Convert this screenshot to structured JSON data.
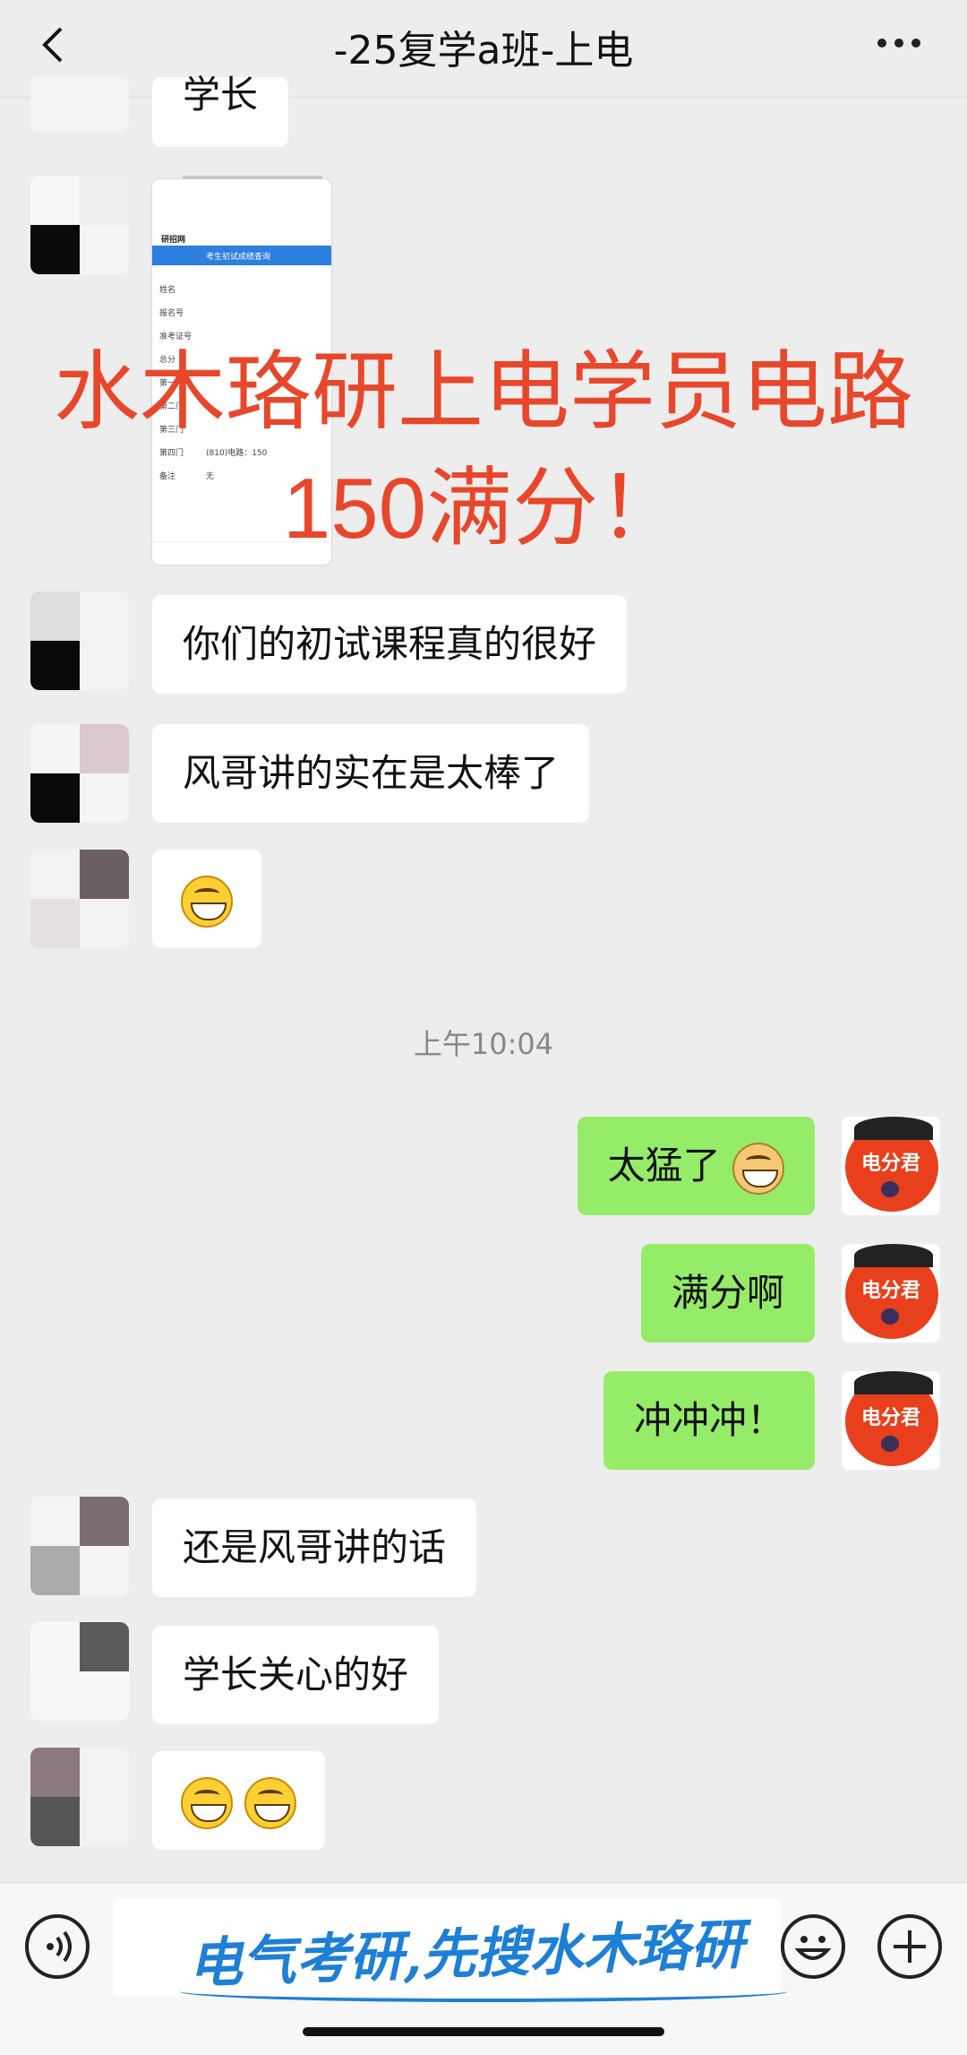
{
  "header": {
    "title": "-25复学a班-上电"
  },
  "messages": {
    "top_partial": "学长",
    "m1": "你们的初试课程真的很好",
    "m2": "风哥讲的实在是太棒了",
    "time": "上午10:04",
    "s1": "太猛了",
    "s2": "满分啊",
    "s3": "冲冲冲！",
    "m4": "还是风哥讲的话",
    "m5": "学长关心的好"
  },
  "card": {
    "brand": "研招网",
    "banner": "考生初试成绩查询",
    "rows": [
      "姓名",
      "报名号",
      "准考证号",
      "总分",
      "第一门",
      "第二门",
      "第三门",
      "第四门",
      "备注"
    ],
    "fourth_value": "(810)电路：150",
    "note_value": "无"
  },
  "overlay": {
    "line1": "水木珞研上电学员电路",
    "line2": "150满分！"
  },
  "avatar_label": "电分君",
  "composer": {
    "slogan": "电气考研,先搜水木珞研"
  },
  "colors": {
    "green_bubble": "#95ec69",
    "overlay_red": "#e8472b",
    "slogan_blue": "#1d7fd6"
  },
  "icons": [
    "back-icon",
    "more-icon",
    "voice-icon",
    "emoji-icon",
    "plus-icon"
  ]
}
